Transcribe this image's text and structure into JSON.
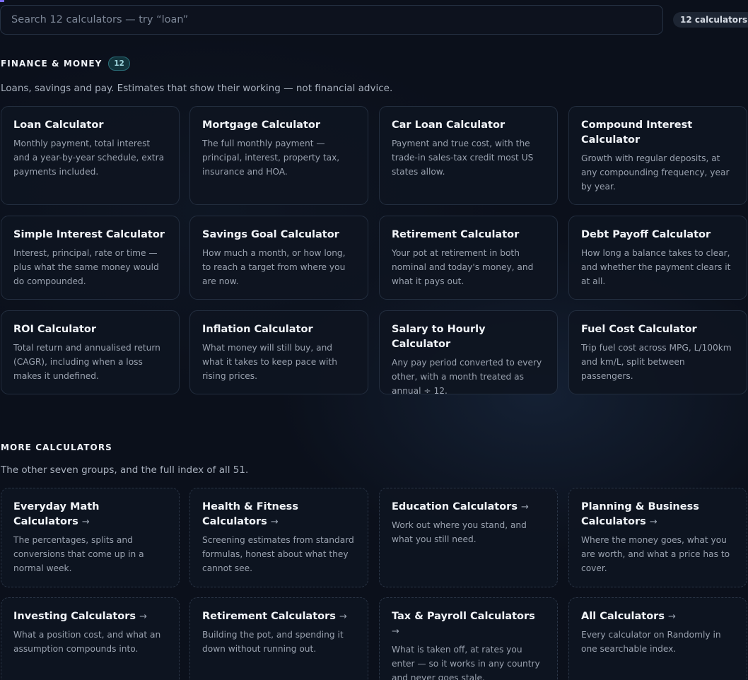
{
  "search": {
    "placeholder": "Search 12 calculators — try “loan”",
    "count_label": "12 calculators"
  },
  "finance": {
    "heading": "FINANCE & MONEY",
    "badge": "12",
    "description": "Loans, savings and pay. Estimates that show their working — not financial advice.",
    "cards": [
      {
        "title": "Loan Calculator",
        "desc": "Monthly payment, total interest and a year-by-year schedule, extra payments included."
      },
      {
        "title": "Mortgage Calculator",
        "desc": "The full monthly payment — principal, interest, property tax, insurance and HOA."
      },
      {
        "title": "Car Loan Calculator",
        "desc": "Payment and true cost, with the trade-in sales-tax credit most US states allow."
      },
      {
        "title": "Compound Interest Calculator",
        "desc": "Growth with regular deposits, at any compounding frequency, year by year."
      },
      {
        "title": "Simple Interest Calculator",
        "desc": "Interest, principal, rate or time — plus what the same money would do compounded."
      },
      {
        "title": "Savings Goal Calculator",
        "desc": "How much a month, or how long, to reach a target from where you are now."
      },
      {
        "title": "Retirement Calculator",
        "desc": "Your pot at retirement in both nominal and today's money, and what it pays out."
      },
      {
        "title": "Debt Payoff Calculator",
        "desc": "How long a balance takes to clear, and whether the payment clears it at all."
      },
      {
        "title": "ROI Calculator",
        "desc": "Total return and annualised return (CAGR), including when a loss makes it undefined."
      },
      {
        "title": "Inflation Calculator",
        "desc": "What money will still buy, and what it takes to keep pace with rising prices."
      },
      {
        "title": "Salary to Hourly Calculator",
        "desc": "Any pay period converted to every other, with a month treated as annual ÷ 12."
      },
      {
        "title": "Fuel Cost Calculator",
        "desc": "Trip fuel cost across MPG, L/100km and km/L, split between passengers."
      }
    ]
  },
  "more": {
    "heading": "MORE CALCULATORS",
    "description": "The other seven groups, and the full index of all 51.",
    "arrow": "→",
    "cards": [
      {
        "title": "Everyday Math Calculators",
        "desc": "The percentages, splits and conversions that come up in a normal week."
      },
      {
        "title": "Health & Fitness Calculators",
        "desc": "Screening estimates from standard formulas, honest about what they cannot see."
      },
      {
        "title": "Education Calculators",
        "desc": "Work out where you stand, and what you still need."
      },
      {
        "title": "Planning & Business Calculators",
        "desc": "Where the money goes, what you are worth, and what a price has to cover."
      },
      {
        "title": "Investing Calculators",
        "desc": "What a position cost, and what an assumption compounds into."
      },
      {
        "title": "Retirement Calculators",
        "desc": "Building the pot, and spending it down without running out."
      },
      {
        "title": "Tax & Payroll Calculators",
        "desc": "What is taken off, at rates you enter — so it works in any country and never goes stale."
      },
      {
        "title": "All Calculators",
        "desc": "Every calculator on Randomly in one searchable index."
      }
    ]
  }
}
